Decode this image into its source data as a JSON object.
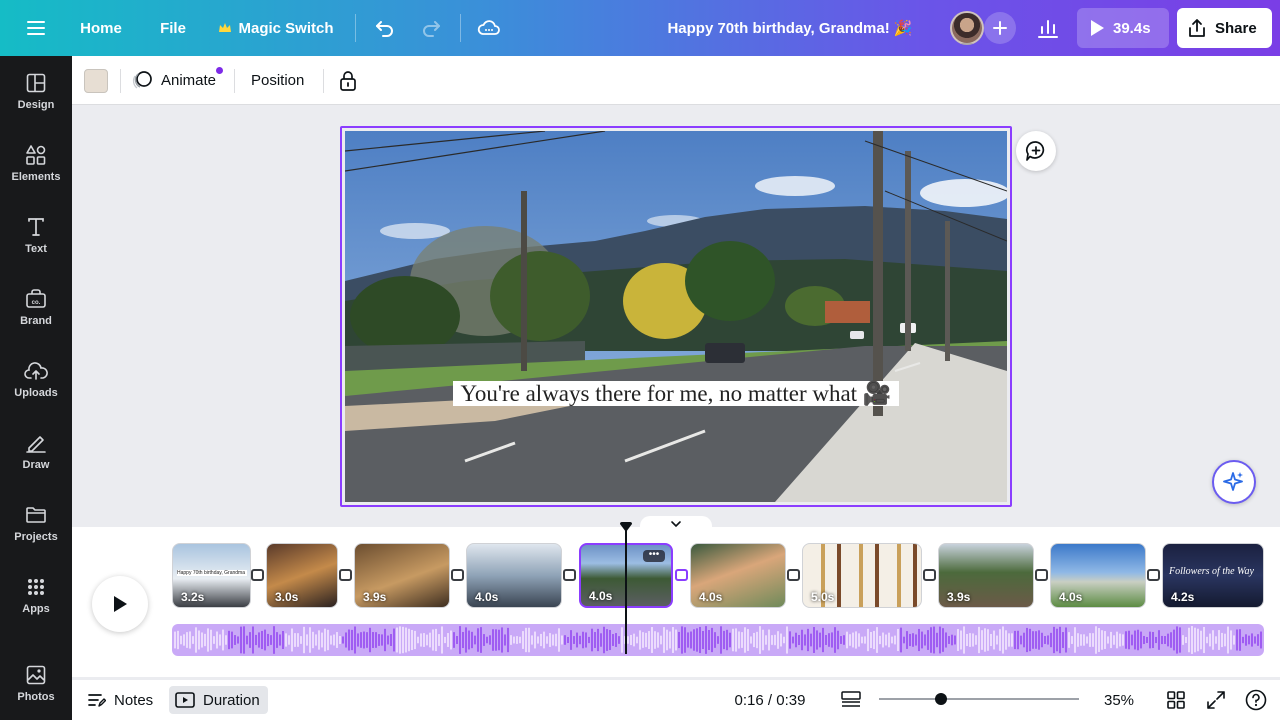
{
  "topbar": {
    "menu_icon": "hamburger-menu-icon",
    "home": "Home",
    "file": "File",
    "magic_switch": "Magic Switch",
    "doc_title": "Happy 70th birthday, Grandma! 🎉",
    "play_duration": "39.4s",
    "share": "Share"
  },
  "sidebar": {
    "items": [
      {
        "label": "Design",
        "icon": "design-icon"
      },
      {
        "label": "Elements",
        "icon": "elements-icon"
      },
      {
        "label": "Text",
        "icon": "text-icon"
      },
      {
        "label": "Brand",
        "icon": "brand-icon"
      },
      {
        "label": "Uploads",
        "icon": "uploads-icon"
      },
      {
        "label": "Draw",
        "icon": "draw-icon"
      },
      {
        "label": "Projects",
        "icon": "projects-icon"
      },
      {
        "label": "Apps",
        "icon": "apps-icon"
      },
      {
        "label": "Photos",
        "icon": "photos-icon"
      }
    ]
  },
  "context_toolbar": {
    "text_color": "#e7ded3",
    "animate": "Animate",
    "position": "Position"
  },
  "canvas": {
    "caption": "You're always there for me, no matter what 🎥"
  },
  "timeline": {
    "clips": [
      {
        "duration": "3.2s",
        "title": "Happy 70th birthday, Grandma"
      },
      {
        "duration": "3.0s"
      },
      {
        "duration": "3.9s"
      },
      {
        "duration": "4.0s"
      },
      {
        "duration": "4.0s",
        "selected": true
      },
      {
        "duration": "4.0s"
      },
      {
        "duration": "5.0s"
      },
      {
        "duration": "3.9s"
      },
      {
        "duration": "4.0s"
      },
      {
        "duration": "4.2s",
        "title": "Followers of the Way"
      }
    ]
  },
  "footer": {
    "notes": "Notes",
    "duration": "Duration",
    "time": "0:16 / 0:39",
    "zoom": "35%",
    "zoom_fraction": 0.31
  },
  "colors": {
    "accent": "#8b3dff",
    "sidebar_bg": "#18191b"
  }
}
